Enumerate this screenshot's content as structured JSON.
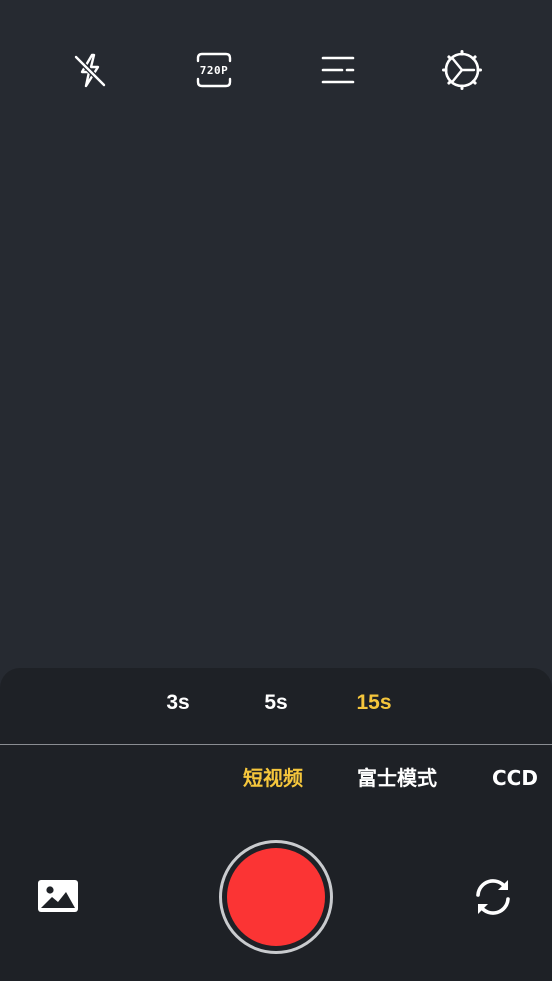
{
  "top_bar": {
    "flash_icon": "flash-off-icon",
    "resolution_icon": "resolution-icon",
    "resolution_label": "720P",
    "filter_icon": "adjust-icon",
    "settings_icon": "gear-icon"
  },
  "durations": {
    "items": [
      "3s",
      "5s",
      "15s"
    ],
    "selected": "15s"
  },
  "modes": {
    "items": [
      "短视频",
      "富士模式",
      "CCD"
    ],
    "selected": "短视频"
  },
  "controls": {
    "gallery_icon": "image-icon",
    "shutter": "record-button",
    "switch_icon": "camera-switch-icon"
  },
  "colors": {
    "background": "#262a31",
    "panel": "#1e2126",
    "accent": "#f5c63c",
    "record": "#fb3434",
    "text": "#ffffff"
  }
}
